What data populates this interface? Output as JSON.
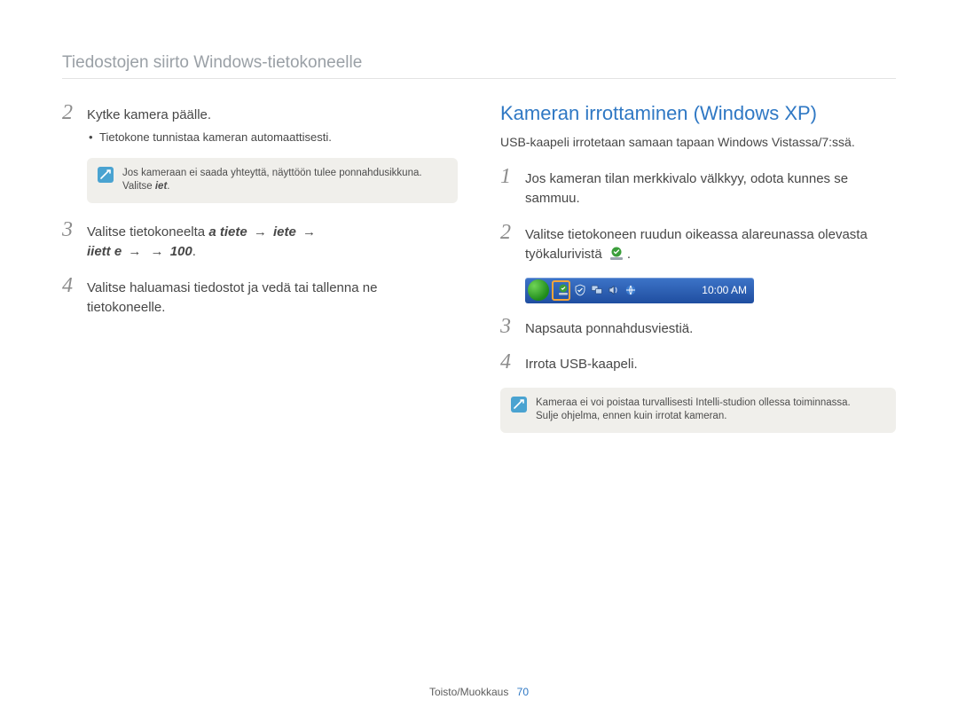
{
  "header": "Tiedostojen siirto Windows-tietokoneelle",
  "left": {
    "step2": {
      "num": "2",
      "text": "Kytke kamera päälle.",
      "bullet": "Tietokone tunnistaa kameran automaattisesti."
    },
    "note": {
      "line1": "Jos kameraan ei saada yhteyttä, näyttöön tulee ponnahdusikkuna.",
      "line2_prefix": "Valitse ",
      "line2_italic": "iet"
    },
    "step3": {
      "num": "3",
      "prefix": "Valitse tietokoneelta ",
      "italic1": "a tiete",
      "arrow1": "→",
      "italic2": "iete",
      "arrow2": "→",
      "italic3": "iiett e",
      "arrow3": "→",
      "arrow4": "→",
      "tail": "100",
      "dot": "."
    },
    "step4": {
      "num": "4",
      "text": "Valitse haluamasi tiedostot ja vedä tai tallenna ne tietokoneelle."
    }
  },
  "right": {
    "heading": "Kameran irrottaminen (Windows XP)",
    "sub": "USB-kaapeli irrotetaan samaan tapaan Windows Vistassa/7:ssä.",
    "step1": {
      "num": "1",
      "text": "Jos kameran tilan merkkivalo välkkyy, odota kunnes se sammuu."
    },
    "step2": {
      "num": "2",
      "text": "Valitse tietokoneen ruudun oikeassa alareunassa olevasta työkalurivistä",
      "dot": "."
    },
    "taskbar_clock": "10:00 AM",
    "step3": {
      "num": "3",
      "text": "Napsauta ponnahdusviestiä."
    },
    "step4": {
      "num": "4",
      "text": "Irrota USB-kaapeli."
    },
    "note": {
      "line1": "Kameraa ei voi poistaa turvallisesti Intelli-studion ollessa toiminnassa.",
      "line2": "Sulje ohjelma, ennen kuin irrotat kameran."
    }
  },
  "footer": {
    "section": "Toisto/Muokkaus",
    "page": "70"
  }
}
